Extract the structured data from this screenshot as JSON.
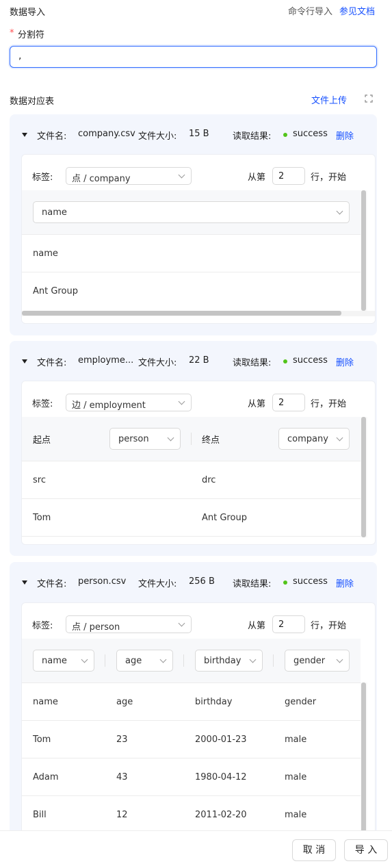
{
  "header": {
    "title": "数据导入",
    "cli_import": "命令行导入",
    "docs_link": "参见文档"
  },
  "separator": {
    "required_mark": "*",
    "label": "分割符",
    "value": ","
  },
  "mapping": {
    "title": "数据对应表",
    "upload_link": "文件上传"
  },
  "labels": {
    "filename": "文件名:",
    "filesize": "文件大小:",
    "result": "读取结果:",
    "delete": "删除",
    "tag": "标签:",
    "from_row": "从第",
    "row_start": "行，开始"
  },
  "files": [
    {
      "name": "company.csv",
      "size": "15 B",
      "status": "success",
      "tag": "点 / company",
      "start_row": "2",
      "columns": [
        "name"
      ],
      "rows": [
        [
          "name"
        ],
        [
          "Ant Group"
        ]
      ]
    },
    {
      "name": "employme...",
      "size": "22 B",
      "status": "success",
      "tag": "边 / employment",
      "start_row": "2",
      "edge": {
        "source_label": "起点",
        "source_value": "person",
        "target_label": "终点",
        "target_value": "company"
      },
      "rows": [
        [
          "src",
          "drc"
        ],
        [
          "Tom",
          "Ant Group"
        ]
      ]
    },
    {
      "name": "person.csv",
      "size": "256 B",
      "status": "success",
      "tag": "点 / person",
      "start_row": "2",
      "columns": [
        "name",
        "age",
        "birthday",
        "gender"
      ],
      "rows": [
        [
          "name",
          "age",
          "birthday",
          "gender"
        ],
        [
          "Tom",
          "23",
          "2000-01-23",
          "male"
        ],
        [
          "Adam",
          "43",
          "1980-04-12",
          "male"
        ],
        [
          "Bill",
          "12",
          "2011-02-20",
          "male"
        ]
      ]
    }
  ],
  "footer": {
    "cancel": "取 消",
    "import": "导 入"
  },
  "colors": {
    "accent": "#1650ff",
    "success": "#52c41a",
    "card_bg": "#f3f6fd"
  }
}
